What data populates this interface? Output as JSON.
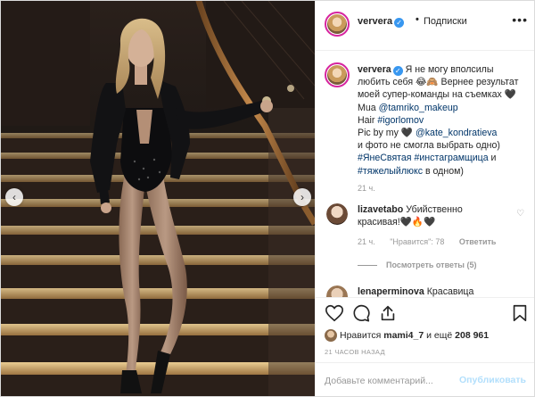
{
  "post": {
    "username": "ververa",
    "follow_status": "Подписки",
    "more_icon": "more-horizontal-icon",
    "verified_icon": "verified-badge-icon"
  },
  "caption": {
    "username": "ververa",
    "text_line1": "Я не могу вполсилы",
    "text_line2": "любить себя 😂🙈 Вернее результат",
    "text_line3": "моей супер-команды на съемках 🖤",
    "mua_label": "Mua ",
    "mua_handle": "@tamriko_makeup",
    "hair_label": "Hair ",
    "hair_handle": "#igorlomov",
    "pic_label": "Pic by my 🖤 ",
    "pic_handle": "@kate_kondratieva",
    "text_line7": "и фото не смогла выбрать одно)",
    "tag1": "#ЯнеСвятая",
    "tag2": "#инстаграмщица",
    "tag_join": " и",
    "tag3": "#тяжелыйлюкс",
    "tag_tail": " в одном)",
    "time": "21 ч."
  },
  "comments": [
    {
      "username": "lizavetabo",
      "text_line1": "Убийственно",
      "text_line2": "красивая!🖤🔥🖤",
      "time": "21 ч.",
      "likes": "\"Нравится\": 78",
      "reply": "Ответить",
      "view_replies": "Посмотреть ответы (5)"
    },
    {
      "username": "lenaperminova",
      "text_line1": "Красавица"
    }
  ],
  "likes": {
    "prefix": "Нравится ",
    "user": "mami4_7",
    "and_more": " и ещё ",
    "count": "208 961"
  },
  "timestamp": "21 ЧАСОВ НАЗАД",
  "add_comment": {
    "placeholder": "Добавьте комментарий...",
    "publish": "Опубликовать"
  },
  "colors": {
    "verified": "#3897f0",
    "link": "#003569",
    "publish_disabled": "#b2dffc",
    "story_ring": "#d6249f"
  }
}
